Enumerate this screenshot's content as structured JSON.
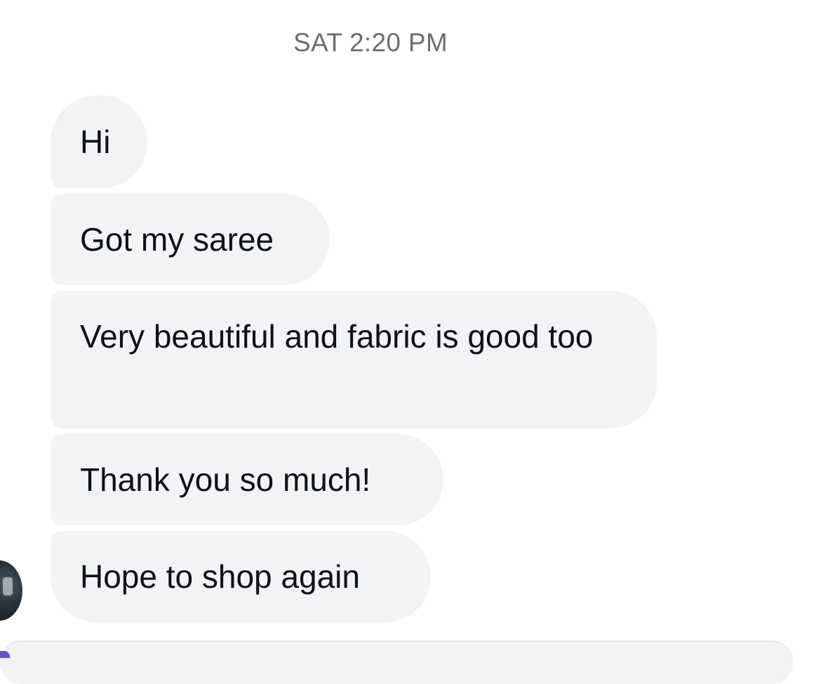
{
  "conversation": {
    "timestamp": "SAT 2:20 PM",
    "messages": [
      {
        "text": "Hi"
      },
      {
        "text": "Got my saree"
      },
      {
        "text": "Very beautiful and fabric is good too"
      },
      {
        "text": "Thank you so much!"
      },
      {
        "text": "Hope to shop again"
      }
    ]
  },
  "colors": {
    "bubble": "#f1f3f4",
    "text": "#0f1114",
    "timestamp": "#6b6e72",
    "accent": "#6a4fd8"
  }
}
